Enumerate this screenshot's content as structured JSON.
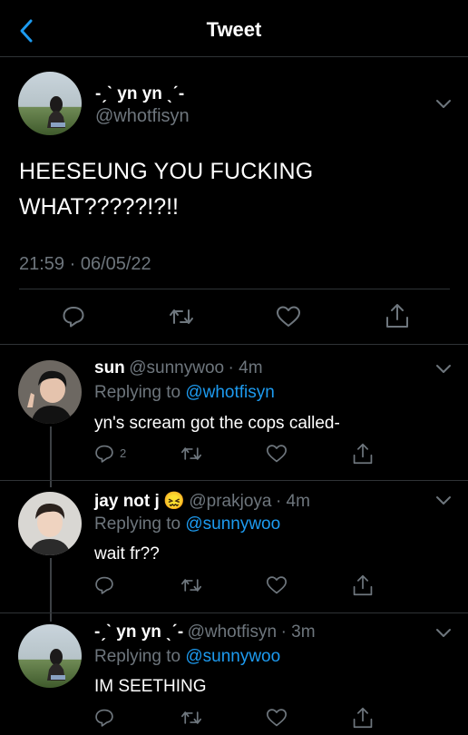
{
  "header": {
    "title": "Tweet"
  },
  "main_tweet": {
    "display_name": "-ˏˋ yn yn ˎˊ-",
    "handle": "@whotfisyn",
    "text_line1": "HEESEUNG YOU FUCKING",
    "text_line2": "WHAT?????!?!!",
    "timestamp": "21:59 · 06/05/22"
  },
  "replies": [
    {
      "display_name": "sun",
      "handle": "@sunnywoo",
      "age": "· 4m",
      "replying_prefix": "Replying to",
      "replying_to": "@whotfisyn",
      "text": "yn's scream got the cops called-",
      "reply_count": "2",
      "emoji": ""
    },
    {
      "display_name": "jay not j",
      "handle": "@prakjoya",
      "age": "· 4m",
      "replying_prefix": "Replying to",
      "replying_to": "@sunnywoo",
      "text": "wait fr??",
      "reply_count": "",
      "emoji": "😖"
    },
    {
      "display_name": "-ˏˋ yn yn ˎˊ-",
      "handle": "@whotfisyn",
      "age": "· 3m",
      "replying_prefix": "Replying to",
      "replying_to": "@sunnywoo",
      "text": "IM SEETHING",
      "reply_count": "",
      "emoji": ""
    }
  ],
  "icons": [
    "back-chevron-icon",
    "caret-down-icon",
    "reply-icon",
    "retweet-icon",
    "like-icon",
    "share-icon"
  ],
  "colors": {
    "background": "#000000",
    "text": "#ffffff",
    "muted": "#6e767d",
    "link": "#1d9bf0",
    "divider": "#2f3336"
  }
}
